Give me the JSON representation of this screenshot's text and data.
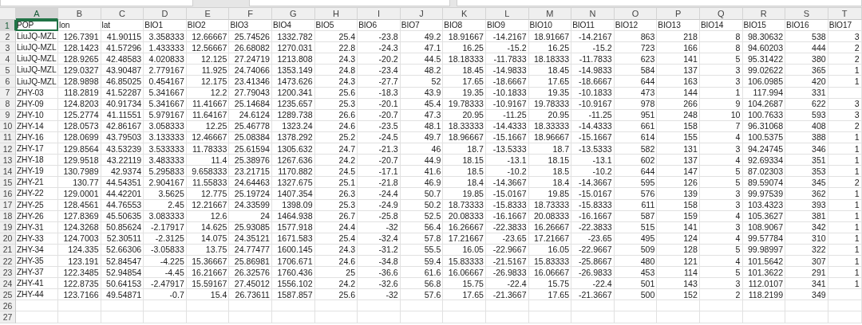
{
  "columns": [
    {
      "label": "A",
      "selected": true
    },
    {
      "label": "B",
      "selected": false
    },
    {
      "label": "C",
      "selected": false
    },
    {
      "label": "D",
      "selected": false
    },
    {
      "label": "E",
      "selected": false
    },
    {
      "label": "F",
      "selected": false
    },
    {
      "label": "G",
      "selected": false
    },
    {
      "label": "H",
      "selected": false
    },
    {
      "label": "I",
      "selected": false
    },
    {
      "label": "J",
      "selected": false
    },
    {
      "label": "K",
      "selected": false
    },
    {
      "label": "L",
      "selected": false
    },
    {
      "label": "M",
      "selected": false
    },
    {
      "label": "N",
      "selected": false
    },
    {
      "label": "O",
      "selected": false
    },
    {
      "label": "P",
      "selected": false
    },
    {
      "label": "Q",
      "selected": false
    },
    {
      "label": "R",
      "selected": false
    },
    {
      "label": "S",
      "selected": false
    },
    {
      "label": "T",
      "selected": false
    }
  ],
  "rows": [
    {
      "number": "1",
      "selected": true,
      "kind": "header",
      "cells": [
        "POP",
        "lon",
        "lat",
        "BIO1",
        "BIO2",
        "BIO3",
        "BIO4",
        "BIO5",
        "BIO6",
        "BIO7",
        "BIO8",
        "BIO9",
        "BIO10",
        "BIO11",
        "BIO12",
        "BIO13",
        "BIO14",
        "BIO15",
        "BIO16",
        "BIO17"
      ]
    },
    {
      "number": "2",
      "selected": false,
      "kind": "data",
      "cells": [
        "LiuJQ-MZL",
        "126.7391",
        "41.90115",
        "3.358333",
        "12.66667",
        "25.74526",
        "1332.782",
        "25.4",
        "-23.8",
        "49.2",
        "18.91667",
        "-14.2167",
        "18.91667",
        "-14.2167",
        "863",
        "218",
        "8",
        "98.30632",
        "538",
        "3"
      ]
    },
    {
      "number": "3",
      "selected": false,
      "kind": "data",
      "cells": [
        "LiuJQ-MZL",
        "128.1423",
        "41.57296",
        "1.433333",
        "12.56667",
        "26.68082",
        "1270.031",
        "22.8",
        "-24.3",
        "47.1",
        "16.25",
        "-15.2",
        "16.25",
        "-15.2",
        "723",
        "166",
        "8",
        "94.60203",
        "444",
        "2"
      ]
    },
    {
      "number": "4",
      "selected": false,
      "kind": "data",
      "cells": [
        "LiuJQ-MZL",
        "128.9265",
        "42.48583",
        "4.020833",
        "12.125",
        "27.24719",
        "1213.808",
        "24.3",
        "-20.2",
        "44.5",
        "18.18333",
        "-11.7833",
        "18.18333",
        "-11.7833",
        "623",
        "141",
        "5",
        "95.31422",
        "380",
        "2"
      ]
    },
    {
      "number": "5",
      "selected": false,
      "kind": "data",
      "cells": [
        "LiuJQ-MZL",
        "129.0327",
        "43.90487",
        "2.779167",
        "11.925",
        "24.74066",
        "1353.149",
        "24.8",
        "-23.4",
        "48.2",
        "18.45",
        "-14.9833",
        "18.45",
        "-14.9833",
        "584",
        "137",
        "3",
        "99.02622",
        "365",
        "1"
      ]
    },
    {
      "number": "6",
      "selected": false,
      "kind": "data",
      "cells": [
        "LiuJQ-MZL",
        "128.9898",
        "46.85025",
        "0.454167",
        "12.175",
        "23.41346",
        "1473.626",
        "24.3",
        "-27.7",
        "52",
        "17.65",
        "-18.6667",
        "17.65",
        "-18.6667",
        "644",
        "163",
        "3",
        "106.0985",
        "420",
        "1"
      ]
    },
    {
      "number": "7",
      "selected": false,
      "kind": "data",
      "cells": [
        "ZHY-03",
        "118.2819",
        "41.52287",
        "5.341667",
        "12.2",
        "27.79043",
        "1200.341",
        "25.6",
        "-18.3",
        "43.9",
        "19.35",
        "-10.1833",
        "19.35",
        "-10.1833",
        "473",
        "144",
        "1",
        "117.994",
        "331"
      ]
    },
    {
      "number": "8",
      "selected": false,
      "kind": "data",
      "cells": [
        "ZHY-09",
        "124.8203",
        "40.91734",
        "5.341667",
        "11.41667",
        "25.14684",
        "1235.657",
        "25.3",
        "-20.1",
        "45.4",
        "19.78333",
        "-10.9167",
        "19.78333",
        "-10.9167",
        "978",
        "266",
        "9",
        "104.2687",
        "622",
        "3"
      ]
    },
    {
      "number": "9",
      "selected": false,
      "kind": "data",
      "cells": [
        "ZHY-10",
        "125.2774",
        "41.11551",
        "5.979167",
        "11.64167",
        "24.6124",
        "1289.738",
        "26.6",
        "-20.7",
        "47.3",
        "20.95",
        "-11.25",
        "20.95",
        "-11.25",
        "951",
        "248",
        "10",
        "100.7633",
        "593",
        "3"
      ]
    },
    {
      "number": "10",
      "selected": false,
      "kind": "data",
      "cells": [
        "ZHY-14",
        "128.0573",
        "42.86167",
        "3.058333",
        "12.25",
        "25.46778",
        "1323.24",
        "24.6",
        "-23.5",
        "48.1",
        "18.33333",
        "-14.4333",
        "18.33333",
        "-14.4333",
        "661",
        "158",
        "7",
        "96.31068",
        "408",
        "2"
      ]
    },
    {
      "number": "11",
      "selected": false,
      "kind": "data",
      "cells": [
        "ZHY-16",
        "128.0699",
        "43.79503",
        "3.133333",
        "12.46667",
        "25.08384",
        "1378.292",
        "25.2",
        "-24.5",
        "49.7",
        "18.96667",
        "-15.1667",
        "18.96667",
        "-15.1667",
        "614",
        "155",
        "4",
        "100.5375",
        "388",
        "1"
      ]
    },
    {
      "number": "12",
      "selected": false,
      "kind": "data",
      "cells": [
        "ZHY-17",
        "129.8564",
        "43.53239",
        "3.533333",
        "11.78333",
        "25.61594",
        "1305.632",
        "24.7",
        "-21.3",
        "46",
        "18.7",
        "-13.5333",
        "18.7",
        "-13.5333",
        "582",
        "131",
        "3",
        "94.24745",
        "346",
        "1"
      ]
    },
    {
      "number": "13",
      "selected": false,
      "kind": "data",
      "cells": [
        "ZHY-18",
        "129.9518",
        "43.22119",
        "3.483333",
        "11.4",
        "25.38976",
        "1267.636",
        "24.2",
        "-20.7",
        "44.9",
        "18.15",
        "-13.1",
        "18.15",
        "-13.1",
        "602",
        "137",
        "4",
        "92.69334",
        "351",
        "1"
      ]
    },
    {
      "number": "14",
      "selected": false,
      "kind": "data",
      "cells": [
        "ZHY-19",
        "130.7989",
        "42.9374",
        "5.295833",
        "9.658333",
        "23.21715",
        "1170.882",
        "24.5",
        "-17.1",
        "41.6",
        "18.5",
        "-10.2",
        "18.5",
        "-10.2",
        "644",
        "147",
        "5",
        "87.02303",
        "353",
        "1"
      ]
    },
    {
      "number": "15",
      "selected": false,
      "kind": "data",
      "cells": [
        "ZHY-21",
        "130.77",
        "44.54351",
        "2.904167",
        "11.55833",
        "24.64463",
        "1327.675",
        "25.1",
        "-21.8",
        "46.9",
        "18.4",
        "-14.3667",
        "18.4",
        "-14.3667",
        "595",
        "126",
        "5",
        "89.59074",
        "345",
        "2"
      ]
    },
    {
      "number": "16",
      "selected": false,
      "kind": "data",
      "cells": [
        "ZHY-22",
        "129.0001",
        "44.42201",
        "3.5625",
        "12.775",
        "25.19724",
        "1407.354",
        "26.3",
        "-24.4",
        "50.7",
        "19.85",
        "-15.0167",
        "19.85",
        "-15.0167",
        "576",
        "139",
        "3",
        "99.97539",
        "362",
        "1"
      ]
    },
    {
      "number": "17",
      "selected": false,
      "kind": "data",
      "cells": [
        "ZHY-25",
        "128.4561",
        "44.76553",
        "2.45",
        "12.21667",
        "24.33599",
        "1398.09",
        "25.3",
        "-24.9",
        "50.2",
        "18.73333",
        "-15.8333",
        "18.73333",
        "-15.8333",
        "611",
        "158",
        "3",
        "103.4323",
        "393",
        "1"
      ]
    },
    {
      "number": "18",
      "selected": false,
      "kind": "data",
      "cells": [
        "ZHY-26",
        "127.8369",
        "45.50635",
        "3.083333",
        "12.6",
        "24",
        "1464.938",
        "26.7",
        "-25.8",
        "52.5",
        "20.08333",
        "-16.1667",
        "20.08333",
        "-16.1667",
        "587",
        "159",
        "4",
        "105.3627",
        "381",
        "1"
      ]
    },
    {
      "number": "19",
      "selected": false,
      "kind": "data",
      "cells": [
        "ZHY-31",
        "124.3268",
        "50.85624",
        "-2.17917",
        "14.625",
        "25.93085",
        "1577.918",
        "24.4",
        "-32",
        "56.4",
        "16.26667",
        "-22.3833",
        "16.26667",
        "-22.3833",
        "515",
        "141",
        "3",
        "108.9067",
        "342",
        "1"
      ]
    },
    {
      "number": "20",
      "selected": false,
      "kind": "data",
      "cells": [
        "ZHY-33",
        "124.7003",
        "52.30511",
        "-2.3125",
        "14.075",
        "24.35121",
        "1671.583",
        "25.4",
        "-32.4",
        "57.8",
        "17.21667",
        "-23.65",
        "17.21667",
        "-23.65",
        "495",
        "124",
        "4",
        "99.57784",
        "310",
        "1"
      ]
    },
    {
      "number": "21",
      "selected": false,
      "kind": "data",
      "cells": [
        "ZHY-34",
        "124.335",
        "52.66306",
        "-3.05833",
        "13.75",
        "24.77477",
        "1600.145",
        "24.3",
        "-31.2",
        "55.5",
        "16.05",
        "-22.9667",
        "16.05",
        "-22.9667",
        "509",
        "128",
        "5",
        "99.98997",
        "322",
        "1"
      ]
    },
    {
      "number": "22",
      "selected": false,
      "kind": "data",
      "cells": [
        "ZHY-35",
        "123.191",
        "52.84547",
        "-4.225",
        "15.36667",
        "25.86981",
        "1706.671",
        "24.6",
        "-34.8",
        "59.4",
        "15.83333",
        "-21.5167",
        "15.83333",
        "-25.8667",
        "480",
        "121",
        "4",
        "101.5642",
        "307",
        "1"
      ]
    },
    {
      "number": "23",
      "selected": false,
      "kind": "data",
      "cells": [
        "ZHY-37",
        "122.3485",
        "52.94854",
        "-4.45",
        "16.21667",
        "26.32576",
        "1760.436",
        "25",
        "-36.6",
        "61.6",
        "16.06667",
        "-26.9833",
        "16.06667",
        "-26.9833",
        "453",
        "114",
        "5",
        "101.3622",
        "291",
        "1"
      ]
    },
    {
      "number": "24",
      "selected": false,
      "kind": "data",
      "cells": [
        "ZHY-41",
        "122.8735",
        "50.64153",
        "-2.47917",
        "15.59167",
        "27.45012",
        "1556.102",
        "24.2",
        "-32.6",
        "56.8",
        "15.75",
        "-22.4",
        "15.75",
        "-22.4",
        "501",
        "143",
        "3",
        "112.0107",
        "341",
        "1"
      ]
    },
    {
      "number": "25",
      "selected": false,
      "kind": "data",
      "cells": [
        "ZHY-44",
        "123.7166",
        "49.54871",
        "-0.7",
        "15.4",
        "26.73611",
        "1587.857",
        "25.6",
        "-32",
        "57.6",
        "17.65",
        "-21.3667",
        "17.65",
        "-21.3667",
        "500",
        "152",
        "2",
        "118.2199",
        "349"
      ]
    },
    {
      "number": "26",
      "selected": false,
      "kind": "data",
      "cells": []
    },
    {
      "number": "27",
      "selected": false,
      "kind": "data",
      "cells": []
    }
  ]
}
